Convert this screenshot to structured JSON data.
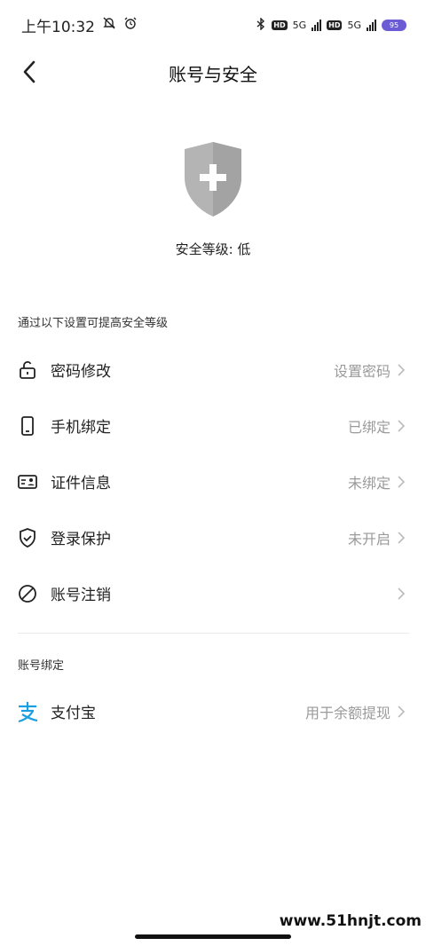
{
  "status_bar": {
    "time": "上午10:32",
    "network_label": "5G",
    "hd_label": "HD",
    "battery_level": "95"
  },
  "header": {
    "title": "账号与安全"
  },
  "security": {
    "level_text": "安全等级: 低",
    "shield_color": "#b0b0b0"
  },
  "section_security": {
    "title": "通过以下设置可提高安全等级",
    "items": [
      {
        "label": "密码修改",
        "value": "设置密码",
        "icon": "lock-icon"
      },
      {
        "label": "手机绑定",
        "value": "已绑定",
        "icon": "phone-icon"
      },
      {
        "label": "证件信息",
        "value": "未绑定",
        "icon": "id-card-icon"
      },
      {
        "label": "登录保护",
        "value": "未开启",
        "icon": "shield-check-icon"
      },
      {
        "label": "账号注销",
        "value": "",
        "icon": "ban-icon"
      }
    ]
  },
  "section_binding": {
    "title": "账号绑定",
    "items": [
      {
        "label": "支付宝",
        "value": "用于余额提现",
        "icon": "alipay-icon",
        "icon_color": "#1aa0e0"
      }
    ]
  },
  "watermark": "www.51hnjt.com"
}
